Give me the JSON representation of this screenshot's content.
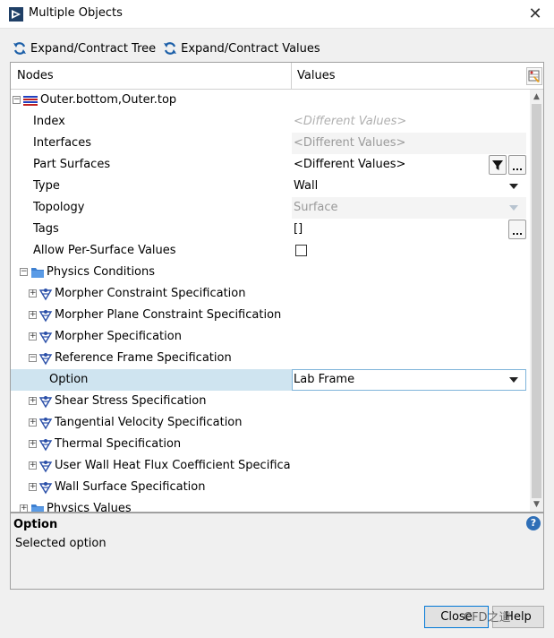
{
  "window": {
    "title": "Multiple Objects"
  },
  "toolbar": {
    "expand_tree": "Expand/Contract Tree",
    "expand_values": "Expand/Contract Values"
  },
  "columns": {
    "nodes": "Nodes",
    "values": "Values"
  },
  "tree": {
    "root": "Outer.bottom,Outer.top",
    "props": {
      "index": {
        "label": "Index",
        "value": "<Different Values>"
      },
      "interfaces": {
        "label": "Interfaces",
        "value": "<Different Values>"
      },
      "part_surfaces": {
        "label": "Part Surfaces",
        "value": "<Different Values>"
      },
      "type": {
        "label": "Type",
        "value": "Wall"
      },
      "topology": {
        "label": "Topology",
        "value": "Surface"
      },
      "tags": {
        "label": "Tags",
        "value": "[]"
      },
      "allow_per_surface": {
        "label": "Allow Per-Surface Values",
        "checked": false
      }
    },
    "physics_conditions": "Physics Conditions",
    "conditions": [
      "Morpher Constraint Specification",
      "Morpher Plane Constraint Specification",
      "Morpher Specification",
      "Reference Frame Specification"
    ],
    "option": {
      "label": "Option",
      "value": "Lab Frame"
    },
    "conditions_after": [
      "Shear Stress Specification",
      "Tangential Velocity Specification",
      "Thermal Specification",
      "User Wall Heat Flux Coefficient Specification",
      "Wall Surface Specification"
    ],
    "physics_values": "Physics Values"
  },
  "description": {
    "title": "Option",
    "text": "Selected option"
  },
  "buttons": {
    "close": "Close",
    "help": "Help"
  },
  "watermark": "CFD之道",
  "colors": {
    "selected_row": "#cfe4f0",
    "help_icon": "#2f6fb7"
  }
}
